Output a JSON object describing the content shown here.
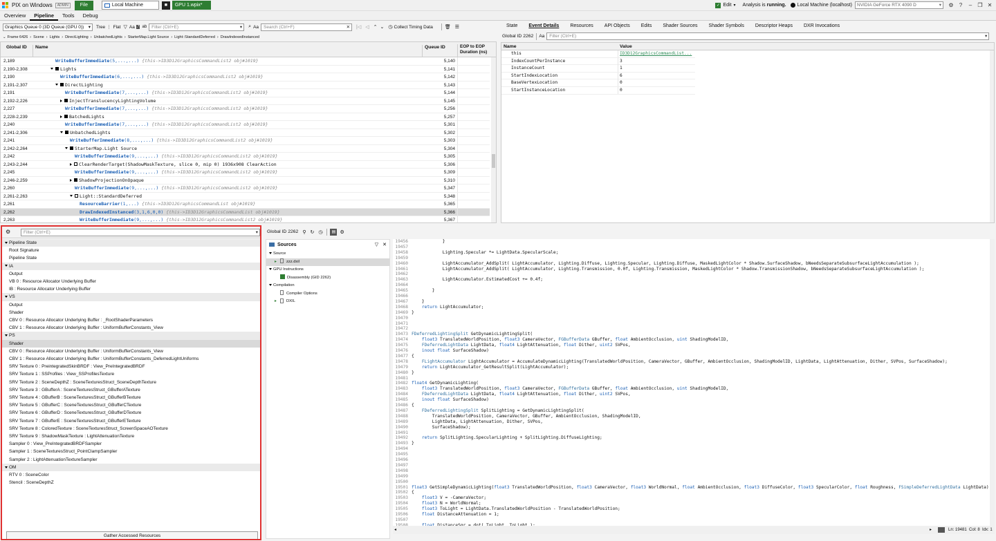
{
  "titlebar": {
    "app": "PIX on Windows",
    "badge": "ADMIN",
    "file_btn": "File",
    "tab_local": "Local Machine",
    "tab_gpu": "GPU 1.wpix*",
    "edit": "Edit",
    "analysis": "Analysis is",
    "analysis_state": "running.",
    "machine": "Local Machine (localhost)",
    "gpu": "NVIDIA GeForce RTX 4090 D"
  },
  "menubar": {
    "tabs": [
      "Overview",
      "Pipeline",
      "Tools",
      "Debug"
    ]
  },
  "events": {
    "queue": "Graphics Queue 0 (3D Queue (GPU 0))",
    "tree_lbl": "Tree",
    "flat_lbl": "Flat",
    "aa": "Aa",
    "filter_placeholder": "Filter (Ctrl+E)",
    "search_placeholder": "Search (Ctrl+F)",
    "collect_timing": "Collect Timing Data",
    "breadcrumbs": [
      "Frame 6426",
      "Scene",
      "Lights",
      "DirectLighting",
      "UnbatchedLights",
      "StarterMap.Light Source",
      "Light::StandardDeferred",
      "DrawIndexedInstanced"
    ],
    "columns": {
      "gid": "Global ID",
      "name": "Name",
      "qid": "Queue ID",
      "eop": "EOP to EOP Duration (ns)"
    },
    "rows": [
      {
        "gid": "2,189",
        "ind": 5,
        "kind": "leaf",
        "name": "WriteBufferImmediate",
        "args": "(5,...,...)",
        "note": "{this->ID3D12GraphicsCommandList2 obj#1019}",
        "qid": "5,140"
      },
      {
        "gid": "2,190-2,308",
        "ind": 4,
        "kind": "open",
        "name": "Lights",
        "args": "",
        "note": "",
        "qid": "5,141"
      },
      {
        "gid": "2,190",
        "ind": 6,
        "kind": "leaf",
        "name": "WriteBufferImmediate",
        "args": "(6,...,...)",
        "note": "{this->ID3D12GraphicsCommandList2 obj#1019}",
        "qid": "5,142"
      },
      {
        "gid": "2,191-2,307",
        "ind": 5,
        "kind": "open",
        "name": "DirectLighting",
        "args": "",
        "note": "",
        "qid": "5,143"
      },
      {
        "gid": "2,191",
        "ind": 7,
        "kind": "leaf",
        "name": "WriteBufferImmediate",
        "args": "(7,...,...)",
        "note": "{this->ID3D12GraphicsCommandList2 obj#1019}",
        "qid": "5,144"
      },
      {
        "gid": "2,192-2,226",
        "ind": 6,
        "kind": "closed",
        "name": "InjectTranslucencyLightingVolume",
        "args": "",
        "note": "",
        "qid": "5,145"
      },
      {
        "gid": "2,227",
        "ind": 7,
        "kind": "leaf",
        "name": "WriteBufferImmediate",
        "args": "(7,...,...)",
        "note": "{this->ID3D12GraphicsCommandList2 obj#1019}",
        "qid": "5,256"
      },
      {
        "gid": "2,228-2,239",
        "ind": 6,
        "kind": "closed",
        "name": "BatchedLights",
        "args": "",
        "note": "",
        "qid": "5,257"
      },
      {
        "gid": "2,240",
        "ind": 7,
        "kind": "leaf",
        "name": "WriteBufferImmediate",
        "args": "(7,...,...)",
        "note": "{this->ID3D12GraphicsCommandList2 obj#1019}",
        "qid": "5,301"
      },
      {
        "gid": "2,241-2,306",
        "ind": 6,
        "kind": "open",
        "name": "UnbatchedLights",
        "args": "",
        "note": "",
        "qid": "5,302"
      },
      {
        "gid": "2,241",
        "ind": 8,
        "kind": "leaf",
        "name": "WriteBufferImmediate",
        "args": "(8,...,...)",
        "note": "{this->ID3D12GraphicsCommandList2 obj#1019}",
        "qid": "5,303"
      },
      {
        "gid": "2,242-2,264",
        "ind": 7,
        "kind": "open",
        "name": "StarterMap.Light Source",
        "args": "",
        "note": "",
        "qid": "5,304"
      },
      {
        "gid": "2,242",
        "ind": 9,
        "kind": "leaf",
        "name": "WriteBufferImmediate",
        "args": "(9,...,...)",
        "note": "{this->ID3D12GraphicsCommandList2 obj#1019}",
        "qid": "5,305"
      },
      {
        "gid": "2,243-2,244",
        "ind": 8,
        "kind": "closedo",
        "name": "ClearRenderTarget(ShadowMaskTexture, slice 0, mip 0) 1936x908 ClearAction",
        "args": "",
        "note": "",
        "qid": "5,306"
      },
      {
        "gid": "2,245",
        "ind": 9,
        "kind": "leaf",
        "name": "WriteBufferImmediate",
        "args": "(9,...,...)",
        "note": "{this->ID3D12GraphicsCommandList2 obj#1019}",
        "qid": "5,309"
      },
      {
        "gid": "2,246-2,259",
        "ind": 8,
        "kind": "closed",
        "name": "ShadowProjectionOnOpaque",
        "args": "",
        "note": "",
        "qid": "5,310"
      },
      {
        "gid": "2,260",
        "ind": 9,
        "kind": "leaf",
        "name": "WriteBufferImmediate",
        "args": "(9,...,...)",
        "note": "{this->ID3D12GraphicsCommandList2 obj#1019}",
        "qid": "5,347"
      },
      {
        "gid": "2,261-2,263",
        "ind": 8,
        "kind": "openo",
        "name": "Light::StandardDeferred",
        "args": "",
        "note": "",
        "qid": "5,348"
      },
      {
        "gid": "2,261",
        "ind": 10,
        "kind": "leaf",
        "name": "ResourceBarrier",
        "args": "(1,...)",
        "note": "{this->ID3D12GraphicsCommandList obj#1019}",
        "qid": "5,365"
      },
      {
        "gid": "2,262",
        "ind": 10,
        "kind": "leaf",
        "name": "DrawIndexedInstanced",
        "args": "(3,1,6,0,0)",
        "note": "{this->ID3D12GraphicsCommandList obj#1019}",
        "qid": "5,366",
        "sel": true
      },
      {
        "gid": "2,263",
        "ind": 10,
        "kind": "leaf",
        "name": "WriteBufferImmediate",
        "args": "(9,...,...)",
        "note": "{this->ID3D12GraphicsCommandList2 obj#1019}",
        "qid": "5,367"
      }
    ]
  },
  "details": {
    "tabs": [
      "State",
      "Event Details",
      "Resources",
      "API Objects",
      "Edits",
      "Shader Sources",
      "Shader Symbols",
      "Descriptor Heaps",
      "DXR Invocations"
    ],
    "gid_label": "Global ID 2262",
    "aa": "Aa",
    "filter_placeholder": "Filter (Ctrl+E)",
    "columns": {
      "name": "Name",
      "value": "Value"
    },
    "rows": [
      {
        "name": "this",
        "value": "ID3D12GraphicsCommandList..."
      },
      {
        "name": "IndexCountPerInstance",
        "value": "3"
      },
      {
        "name": "InstanceCount",
        "value": "1"
      },
      {
        "name": "StartIndexLocation",
        "value": "6"
      },
      {
        "name": "BaseVertexLocation",
        "value": "0"
      },
      {
        "name": "StartInstanceLocation",
        "value": "0"
      }
    ]
  },
  "pipeline": {
    "filter_placeholder": "Filter (Ctrl+E)",
    "gather_btn": "Gather Accessed Resources",
    "items": [
      {
        "t": "sec",
        "label": "Pipeline State"
      },
      {
        "t": "item",
        "label": "Root Signature"
      },
      {
        "t": "item",
        "label": "Pipeline State"
      },
      {
        "t": "sec",
        "label": "IA"
      },
      {
        "t": "item",
        "label": "Output"
      },
      {
        "t": "item",
        "label": "VB 0 : Resource Allocator Underlying Buffer"
      },
      {
        "t": "item",
        "label": "IB : Resource Allocator Underlying Buffer"
      },
      {
        "t": "sec",
        "label": "VS"
      },
      {
        "t": "item",
        "label": "Output"
      },
      {
        "t": "item",
        "label": "Shader"
      },
      {
        "t": "item",
        "label": "CBV 0 : Resource Allocator Underlying Buffer : _RootShaderParameters"
      },
      {
        "t": "item",
        "label": "CBV 1 : Resource Allocator Underlying Buffer : UniformBufferConstants_View"
      },
      {
        "t": "sec",
        "label": "PS"
      },
      {
        "t": "item",
        "label": "Shader",
        "sel": true
      },
      {
        "t": "item",
        "label": "CBV 0 : Resource Allocator Underlying Buffer : UniformBufferConstants_View"
      },
      {
        "t": "item",
        "label": "CBV 1 : Resource Allocator Underlying Buffer : UniformBufferConstants_DeferredLightUniforms"
      },
      {
        "t": "item",
        "label": "SRV Texture 0 : PreintegratedSkinBRDF : View_PreIntegratedBRDF"
      },
      {
        "t": "item",
        "label": "SRV Texture 1 : SSProfiles : View_SSProfilesTexture"
      },
      {
        "t": "item",
        "label": "SRV Texture 2 : SceneDepthZ : SceneTexturesStruct_SceneDepthTexture"
      },
      {
        "t": "item",
        "label": "SRV Texture 3 : GBufferA : SceneTexturesStruct_GBufferATexture"
      },
      {
        "t": "item",
        "label": "SRV Texture 4 : GBufferB : SceneTexturesStruct_GBufferBTexture"
      },
      {
        "t": "item",
        "label": "SRV Texture 5 : GBufferC : SceneTexturesStruct_GBufferCTexture"
      },
      {
        "t": "item",
        "label": "SRV Texture 6 : GBufferD : SceneTexturesStruct_GBufferDTexture"
      },
      {
        "t": "item",
        "label": "SRV Texture 7 : GBufferE : SceneTexturesStruct_GBufferETexture"
      },
      {
        "t": "item",
        "label": "SRV Texture 8 : ColoredTexture : SceneTexturesStruct_ScreenSpaceAOTexture"
      },
      {
        "t": "item",
        "label": "SRV Texture 9 : ShadowMaskTexture : LightAttenuationTexture"
      },
      {
        "t": "item",
        "label": "Sampler 0 : View_PreIntegratedBRDFSampler"
      },
      {
        "t": "item",
        "label": "Sampler 1 : SceneTexturesStruct_PointClampSampler"
      },
      {
        "t": "item",
        "label": "Sampler 2 : LightAttenuationTextureSampler"
      },
      {
        "t": "sec",
        "label": "OM"
      },
      {
        "t": "item",
        "label": "RTV 0 : SceneColor"
      },
      {
        "t": "item",
        "label": "Stencil : SceneDepthZ"
      }
    ]
  },
  "shader": {
    "gid_label": "Global ID 2262",
    "sources_title": "Sources",
    "tree": [
      {
        "ind": 0,
        "kind": "cat",
        "label": "Source"
      },
      {
        "ind": 1,
        "kind": "file",
        "label": "zzz.dxil",
        "sel": true
      },
      {
        "ind": 0,
        "kind": "cat",
        "label": "GPU Instructions"
      },
      {
        "ind": 1,
        "kind": "dis",
        "label": "Disassembly (GID 2262)"
      },
      {
        "ind": 0,
        "kind": "cat",
        "label": "Compilation"
      },
      {
        "ind": 1,
        "kind": "doc",
        "label": "Compiler Options"
      },
      {
        "ind": 1,
        "kind": "file2",
        "label": "DXIL"
      }
    ],
    "status": {
      "ln": "Ln: 19481",
      "col": "Col: 8",
      "idx": "Idx: 1"
    },
    "lines": [
      {
        "n": "19456",
        "c": "            }"
      },
      {
        "n": "19457",
        "c": ""
      },
      {
        "n": "19458",
        "c": "            Lighting.Specular *= LightData.SpecularScale;"
      },
      {
        "n": "19459",
        "c": ""
      },
      {
        "n": "19460",
        "c": "            LightAccumulator_AddSplit( LightAccumulator, Lighting.Diffuse, Lighting.Specular, Lighting.Diffuse, MaskedLightColor * Shadow.SurfaceShadow, bNeedsSeparateSubsurfaceLightAccumulation );"
      },
      {
        "n": "19461",
        "c": "            LightAccumulator_AddSplit( LightAccumulator, Lighting.Transmission, 0.0f, Lighting.Transmission, MaskedLightColor * Shadow.TransmissionShadow, bNeedsSeparateSubsurfaceLightAccumulation );"
      },
      {
        "n": "19462",
        "c": ""
      },
      {
        "n": "19463",
        "c": "            LightAccumulator.EstimatedCost += 0.4f;"
      },
      {
        "n": "19464",
        "c": ""
      },
      {
        "n": "19465",
        "c": "        }"
      },
      {
        "n": "19466",
        "c": ""
      },
      {
        "n": "19467",
        "c": "    }"
      },
      {
        "n": "19468",
        "c": "    return LightAccumulator;"
      },
      {
        "n": "19469",
        "c": "}"
      },
      {
        "n": "19470",
        "c": ""
      },
      {
        "n": "19471",
        "c": ""
      },
      {
        "n": "19472",
        "c": ""
      },
      {
        "n": "19473",
        "c": "FDeferredLightingSplit GetDynamicLightingSplit("
      },
      {
        "n": "19474",
        "c": "    float3 TranslatedWorldPosition, float3 CameraVector, FGBufferData GBuffer, float AmbientOcclusion, uint ShadingModelID,"
      },
      {
        "n": "19475",
        "c": "    FDeferredLightData LightData, float4 LightAttenuation, float Dither, uint2 SVPos,"
      },
      {
        "n": "19476",
        "c": "    inout float SurfaceShadow)"
      },
      {
        "n": "19477",
        "c": "{"
      },
      {
        "n": "19478",
        "c": "    FLightAccumulator LightAccumulator = AccumulateDynamicLighting(TranslatedWorldPosition, CameraVector, GBuffer, AmbientOcclusion, ShadingModelID, LightData, LightAttenuation, Dither, SVPos, SurfaceShadow);"
      },
      {
        "n": "19479",
        "c": "    return LightAccumulator_GetResultSplit(LightAccumulator);"
      },
      {
        "n": "19480",
        "c": "}"
      },
      {
        "n": "19481",
        "c": ""
      },
      {
        "n": "19482",
        "c": "float4 GetDynamicLighting("
      },
      {
        "n": "19483",
        "c": "    float3 TranslatedWorldPosition, float3 CameraVector, FGBufferData GBuffer, float AmbientOcclusion, uint ShadingModelID,"
      },
      {
        "n": "19484",
        "c": "    FDeferredLightData LightData, float4 LightAttenuation, float Dither, uint2 SVPos,"
      },
      {
        "n": "19485",
        "c": "    inout float SurfaceShadow)"
      },
      {
        "n": "19486",
        "c": "{"
      },
      {
        "n": "19487",
        "c": "    FDeferredLightingSplit SplitLighting = GetDynamicLightingSplit("
      },
      {
        "n": "19488",
        "c": "        TranslatedWorldPosition, CameraVector, GBuffer, AmbientOcclusion, ShadingModelID,"
      },
      {
        "n": "19489",
        "c": "        LightData, LightAttenuation, Dither, SVPos,"
      },
      {
        "n": "19490",
        "c": "        SurfaceShadow);"
      },
      {
        "n": "19491",
        "c": ""
      },
      {
        "n": "19492",
        "c": "    return SplitLighting.SpecularLighting + SplitLighting.DiffuseLighting;"
      },
      {
        "n": "19493",
        "c": "}"
      },
      {
        "n": "19494",
        "c": ""
      },
      {
        "n": "19495",
        "c": ""
      },
      {
        "n": "19496",
        "c": ""
      },
      {
        "n": "19497",
        "c": ""
      },
      {
        "n": "19498",
        "c": ""
      },
      {
        "n": "19499",
        "c": ""
      },
      {
        "n": "19500",
        "c": ""
      },
      {
        "n": "19501",
        "c": "float3 GetSimpleDynamicLighting(float3 TranslatedWorldPosition, float3 CameraVector, float3 WorldNormal, float AmbientOcclusion, float3 DiffuseColor, float3 SpecularColor, float Roughness, FSimpleDeferredLightData LightData)"
      },
      {
        "n": "19502",
        "c": "{"
      },
      {
        "n": "19503",
        "c": "    float3 V = -CameraVector;"
      },
      {
        "n": "19504",
        "c": "    float3 N = WorldNormal;"
      },
      {
        "n": "19505",
        "c": "    float3 ToLight = LightData.TranslatedWorldPosition - TranslatedWorldPosition;"
      },
      {
        "n": "19506",
        "c": "    float DistanceAttenuation = 1;"
      },
      {
        "n": "19507",
        "c": ""
      },
      {
        "n": "19508",
        "c": "    float DistanceSqr = dot( ToLight, ToLight );"
      },
      {
        "n": "19509",
        "c": "    float3 L = ToLight * rsqrt( DistanceSqr );"
      }
    ]
  }
}
